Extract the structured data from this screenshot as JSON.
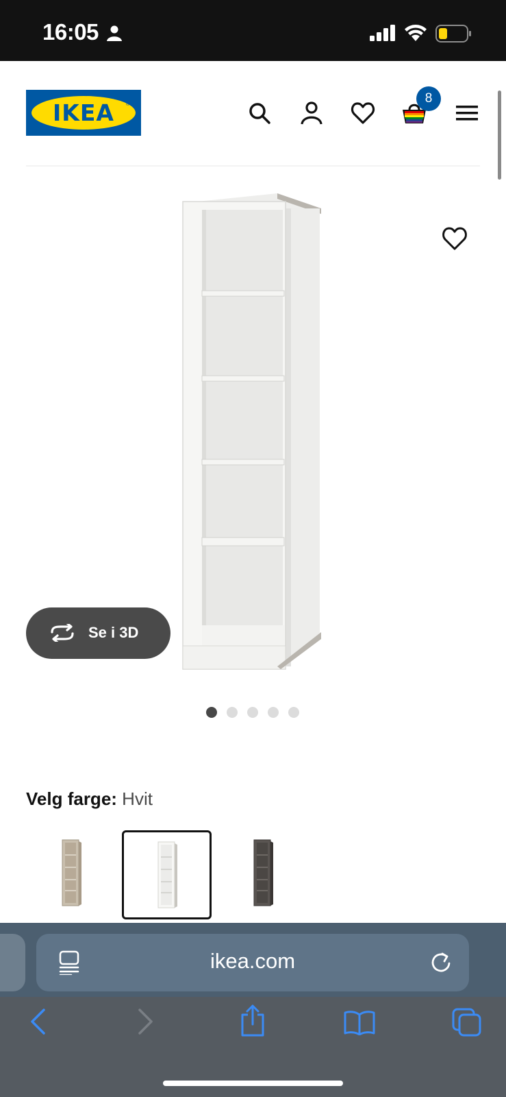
{
  "status_bar": {
    "time": "16:05"
  },
  "header": {
    "logo_text": "IKEA",
    "logo_reg": "®",
    "cart_count": "8",
    "brand_colors": {
      "blue": "#0058a3",
      "yellow": "#ffdb00"
    }
  },
  "product": {
    "view_3d_label": "Se i 3D",
    "image_count": 5,
    "active_image": 1
  },
  "color_selector": {
    "label": "Velg farge:",
    "selected": "Hvit",
    "swatch_colors": [
      "#b7aa97",
      "#f2f2f2",
      "#4b4744"
    ],
    "selected_index": 1
  },
  "browser": {
    "url": "ikea.com"
  }
}
